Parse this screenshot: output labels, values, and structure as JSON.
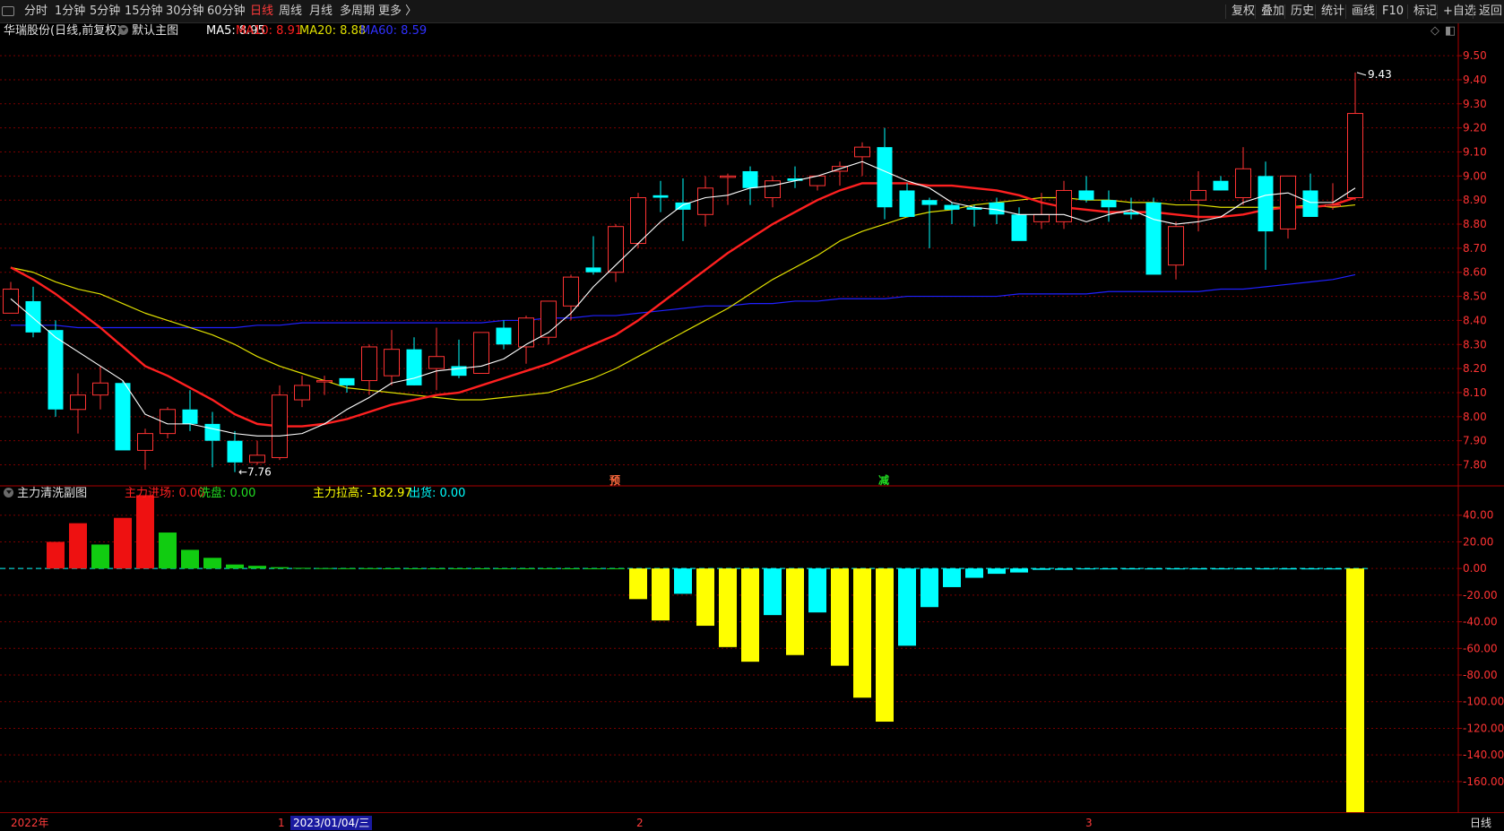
{
  "toolbar": {
    "periods": [
      "分时",
      "1分钟",
      "5分钟",
      "15分钟",
      "30分钟",
      "60分钟",
      "日线",
      "周线",
      "月线",
      "多周期",
      "更多 〉"
    ],
    "active_period": "日线",
    "right_buttons": [
      "复权",
      "叠加",
      "历史",
      "统计",
      "画线",
      "F10",
      "标记",
      "+自选",
      "返回"
    ]
  },
  "colors": {
    "up": "#ff3333",
    "down": "#00ffff",
    "ma5": "#ffffff",
    "ma10": "#ff2020",
    "ma20": "#e0e000",
    "ma60": "#2020ff",
    "accent_red": "#ff3b3b",
    "grid": "#7a0000",
    "ind_red": "#ee1111",
    "ind_green": "#11cc11",
    "ind_yellow": "#ffff00",
    "ind_cyan": "#00ffff"
  },
  "main": {
    "stock_title": "华瑞股份(日线,前复权)",
    "main_label": "默认主图",
    "ma5_label": "MA5: 8.95",
    "ma10_label": "MA10: 8.91",
    "ma20_label": "MA20: 8.88",
    "ma60_label": "MA60: 8.59",
    "high_marker": "9.43",
    "low_marker": "←7.76",
    "signal_yu": "预",
    "signal_jian": "减"
  },
  "sub": {
    "title": "主力清洗副图",
    "zljc_label": "主力进场: 0.00",
    "xp_label": "洗盘: 0.00",
    "zllg_label": "主力拉高: -182.97",
    "ch_label": "出货: 0.00"
  },
  "bottom": {
    "year_label": "2022年",
    "month1": "1",
    "date_label": "2023/01/04/三",
    "month2": "2",
    "month3": "3",
    "period_label": "日线"
  },
  "chart_data": [
    {
      "type": "candlestick",
      "ylim": [
        7.72,
        9.56
      ],
      "ticks": [
        7.8,
        7.9,
        8.0,
        8.1,
        8.2,
        8.3,
        8.4,
        8.5,
        8.6,
        8.7,
        8.8,
        8.9,
        9.0,
        9.1,
        9.2,
        9.3,
        9.4,
        9.5
      ],
      "ohlc": [
        [
          8.43,
          8.56,
          8.43,
          8.53
        ],
        [
          8.48,
          8.54,
          8.33,
          8.35
        ],
        [
          8.36,
          8.4,
          8.0,
          8.03
        ],
        [
          8.03,
          8.18,
          7.93,
          8.09
        ],
        [
          8.09,
          8.21,
          8.03,
          8.14
        ],
        [
          8.14,
          8.15,
          7.86,
          7.86
        ],
        [
          7.86,
          7.95,
          7.78,
          7.93
        ],
        [
          7.93,
          8.04,
          7.91,
          8.03
        ],
        [
          8.03,
          8.11,
          7.94,
          7.97
        ],
        [
          7.97,
          8.02,
          7.79,
          7.9
        ],
        [
          7.9,
          7.94,
          7.77,
          7.81
        ],
        [
          7.81,
          7.9,
          7.8,
          7.84
        ],
        [
          7.83,
          8.13,
          7.82,
          8.09
        ],
        [
          8.07,
          8.17,
          8.04,
          8.13
        ],
        [
          8.15,
          8.17,
          8.09,
          8.15
        ],
        [
          8.16,
          8.16,
          8.1,
          8.13
        ],
        [
          8.15,
          8.3,
          8.09,
          8.29
        ],
        [
          8.17,
          8.36,
          8.13,
          8.28
        ],
        [
          8.28,
          8.33,
          8.22,
          8.13
        ],
        [
          8.2,
          8.37,
          8.11,
          8.25
        ],
        [
          8.21,
          8.32,
          8.16,
          8.17
        ],
        [
          8.18,
          8.35,
          8.18,
          8.35
        ],
        [
          8.37,
          8.4,
          8.28,
          8.3
        ],
        [
          8.29,
          8.42,
          8.22,
          8.41
        ],
        [
          8.33,
          8.48,
          8.3,
          8.48
        ],
        [
          8.46,
          8.59,
          8.4,
          8.58
        ],
        [
          8.62,
          8.75,
          8.59,
          8.6
        ],
        [
          8.6,
          8.8,
          8.56,
          8.79
        ],
        [
          8.72,
          8.93,
          8.7,
          8.91
        ],
        [
          8.92,
          8.98,
          8.85,
          8.91
        ],
        [
          8.89,
          8.99,
          8.73,
          8.86
        ],
        [
          8.84,
          9.0,
          8.79,
          8.95
        ],
        [
          9.0,
          9.01,
          8.88,
          9.0
        ],
        [
          9.02,
          9.04,
          8.88,
          8.95
        ],
        [
          8.91,
          9.0,
          8.87,
          8.98
        ],
        [
          8.99,
          9.04,
          8.95,
          8.98
        ],
        [
          8.96,
          9.0,
          8.94,
          9.0
        ],
        [
          9.02,
          9.06,
          8.96,
          9.04
        ],
        [
          9.08,
          9.14,
          9.0,
          9.12
        ],
        [
          9.12,
          9.2,
          8.82,
          8.87
        ],
        [
          8.94,
          8.97,
          8.83,
          8.83
        ],
        [
          8.9,
          8.91,
          8.7,
          8.88
        ],
        [
          8.88,
          8.89,
          8.8,
          8.86
        ],
        [
          8.87,
          8.88,
          8.79,
          8.86
        ],
        [
          8.89,
          8.91,
          8.8,
          8.84
        ],
        [
          8.84,
          8.87,
          8.73,
          8.73
        ],
        [
          8.81,
          8.93,
          8.78,
          8.84
        ],
        [
          8.81,
          8.98,
          8.78,
          8.94
        ],
        [
          8.94,
          9.0,
          8.89,
          8.9
        ],
        [
          8.9,
          8.94,
          8.81,
          8.87
        ],
        [
          8.85,
          8.91,
          8.82,
          8.84
        ],
        [
          8.89,
          8.91,
          8.59,
          8.59
        ],
        [
          8.63,
          8.81,
          8.57,
          8.79
        ],
        [
          8.9,
          9.02,
          8.77,
          8.94
        ],
        [
          8.98,
          9.0,
          8.96,
          8.94
        ],
        [
          8.91,
          9.12,
          8.88,
          9.03
        ],
        [
          9.0,
          9.06,
          8.61,
          8.77
        ],
        [
          8.78,
          9.0,
          8.74,
          9.0
        ],
        [
          8.94,
          9.01,
          8.83,
          8.83
        ],
        [
          8.88,
          8.97,
          8.86,
          8.88
        ],
        [
          8.91,
          9.43,
          8.9,
          9.26
        ]
      ],
      "ma5": [
        8.49,
        8.41,
        8.33,
        8.27,
        8.21,
        8.15,
        8.01,
        7.97,
        7.97,
        7.95,
        7.93,
        7.92,
        7.92,
        7.93,
        7.97,
        8.03,
        8.08,
        8.14,
        8.16,
        8.19,
        8.2,
        8.21,
        8.24,
        8.3,
        8.35,
        8.43,
        8.54,
        8.63,
        8.72,
        8.81,
        8.88,
        8.91,
        8.92,
        8.95,
        8.96,
        8.98,
        9.0,
        9.03,
        9.06,
        9.02,
        8.98,
        8.95,
        8.89,
        8.87,
        8.86,
        8.84,
        8.84,
        8.84,
        8.81,
        8.84,
        8.86,
        8.82,
        8.8,
        8.81,
        8.83,
        8.89,
        8.92,
        8.93,
        8.89,
        8.89,
        8.95
      ],
      "ma10": [
        8.62,
        8.57,
        8.51,
        8.44,
        8.37,
        8.29,
        8.21,
        8.17,
        8.12,
        8.07,
        8.01,
        7.97,
        7.96,
        7.96,
        7.97,
        7.99,
        8.02,
        8.05,
        8.07,
        8.09,
        8.1,
        8.13,
        8.16,
        8.19,
        8.22,
        8.26,
        8.3,
        8.34,
        8.4,
        8.47,
        8.54,
        8.61,
        8.68,
        8.74,
        8.8,
        8.85,
        8.9,
        8.94,
        8.97,
        8.97,
        8.97,
        8.96,
        8.96,
        8.95,
        8.94,
        8.92,
        8.89,
        8.87,
        8.86,
        8.85,
        8.85,
        8.85,
        8.84,
        8.83,
        8.83,
        8.84,
        8.86,
        8.87,
        8.87,
        8.88,
        8.91
      ],
      "ma20": [
        8.62,
        8.6,
        8.56,
        8.53,
        8.51,
        8.47,
        8.43,
        8.4,
        8.37,
        8.34,
        8.3,
        8.25,
        8.21,
        8.18,
        8.15,
        8.12,
        8.11,
        8.1,
        8.09,
        8.08,
        8.07,
        8.07,
        8.08,
        8.09,
        8.1,
        8.13,
        8.16,
        8.2,
        8.25,
        8.3,
        8.35,
        8.4,
        8.45,
        8.51,
        8.57,
        8.62,
        8.67,
        8.73,
        8.77,
        8.8,
        8.83,
        8.85,
        8.86,
        8.88,
        8.89,
        8.9,
        8.91,
        8.91,
        8.9,
        8.9,
        8.89,
        8.89,
        8.88,
        8.88,
        8.87,
        8.87,
        8.87,
        8.87,
        8.88,
        8.87,
        8.88
      ],
      "ma60": [
        8.38,
        8.38,
        8.38,
        8.37,
        8.37,
        8.37,
        8.37,
        8.37,
        8.37,
        8.37,
        8.37,
        8.38,
        8.38,
        8.39,
        8.39,
        8.39,
        8.39,
        8.39,
        8.39,
        8.39,
        8.39,
        8.39,
        8.4,
        8.4,
        8.41,
        8.41,
        8.42,
        8.42,
        8.43,
        8.44,
        8.45,
        8.46,
        8.46,
        8.47,
        8.47,
        8.48,
        8.48,
        8.49,
        8.49,
        8.49,
        8.5,
        8.5,
        8.5,
        8.5,
        8.5,
        8.51,
        8.51,
        8.51,
        8.51,
        8.52,
        8.52,
        8.52,
        8.52,
        8.52,
        8.53,
        8.53,
        8.54,
        8.55,
        8.56,
        8.57,
        8.59
      ]
    },
    {
      "type": "bar",
      "title": "主力清洗副图",
      "ylim": [
        -182.97,
        58
      ],
      "ticks": [
        40,
        20,
        0,
        -20,
        -40,
        -60,
        -80,
        -100,
        -120,
        -140,
        -160
      ],
      "series": [
        {
          "name": "主力进场",
          "bars": [
            [
              2,
              20
            ],
            [
              3,
              34
            ],
            [
              5,
              38
            ],
            [
              6,
              55
            ]
          ]
        },
        {
          "name": "洗盘",
          "bars": [
            [
              4,
              18
            ],
            [
              7,
              27
            ],
            [
              8,
              14
            ],
            [
              9,
              8
            ],
            [
              10,
              3
            ],
            [
              11,
              2
            ],
            [
              12,
              1
            ],
            [
              13,
              0.5
            ],
            [
              14,
              0.3
            ],
            [
              15,
              0.2
            ],
            [
              16,
              0.2
            ],
            [
              17,
              0.1
            ],
            [
              18,
              0.1
            ],
            [
              19,
              0.1
            ],
            [
              20,
              0.1
            ],
            [
              21,
              0.1
            ],
            [
              22,
              0.1
            ],
            [
              23,
              0.1
            ],
            [
              24,
              0.1
            ],
            [
              25,
              0.1
            ],
            [
              26,
              0.1
            ],
            [
              27,
              0.1
            ]
          ]
        },
        {
          "name": "主力拉高",
          "bars": [
            [
              28,
              -23
            ],
            [
              29,
              -39
            ],
            [
              31,
              -43
            ],
            [
              32,
              -59
            ],
            [
              33,
              -70
            ],
            [
              35,
              -65
            ],
            [
              37,
              -73
            ],
            [
              38,
              -97
            ],
            [
              39,
              -115
            ],
            [
              60,
              -182.97
            ]
          ]
        },
        {
          "name": "出货",
          "bars": [
            [
              30,
              -19
            ],
            [
              34,
              -35
            ],
            [
              36,
              -33
            ],
            [
              40,
              -58
            ],
            [
              41,
              -29
            ],
            [
              42,
              -14
            ],
            [
              43,
              -7
            ],
            [
              44,
              -4
            ],
            [
              45,
              -3
            ],
            [
              46,
              -1
            ],
            [
              47,
              -1
            ],
            [
              48,
              -0.6
            ],
            [
              49,
              -0.5
            ],
            [
              50,
              -0.5
            ],
            [
              51,
              -0.4
            ],
            [
              52,
              -0.4
            ],
            [
              53,
              -0.4
            ],
            [
              54,
              -0.3
            ],
            [
              55,
              -0.3
            ],
            [
              56,
              -0.3
            ],
            [
              57,
              -0.2
            ],
            [
              58,
              -0.2
            ],
            [
              59,
              -0.2
            ]
          ]
        }
      ]
    }
  ]
}
